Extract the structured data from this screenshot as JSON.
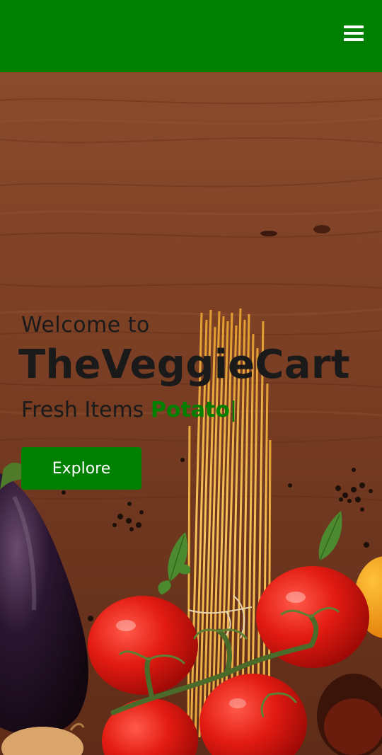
{
  "header": {
    "menu_icon": "hamburger-menu-icon"
  },
  "hero": {
    "welcome_text": "Welcome to",
    "brand_name": "TheVeggieCart",
    "tagline_prefix": "Fresh Items",
    "tagline_typed": "Potato",
    "cursor_char": "|",
    "explore_label": "Explore"
  },
  "colors": {
    "brand_green": "#008000",
    "text_dark": "#1a1a1a",
    "wood": "#7a3f25"
  }
}
